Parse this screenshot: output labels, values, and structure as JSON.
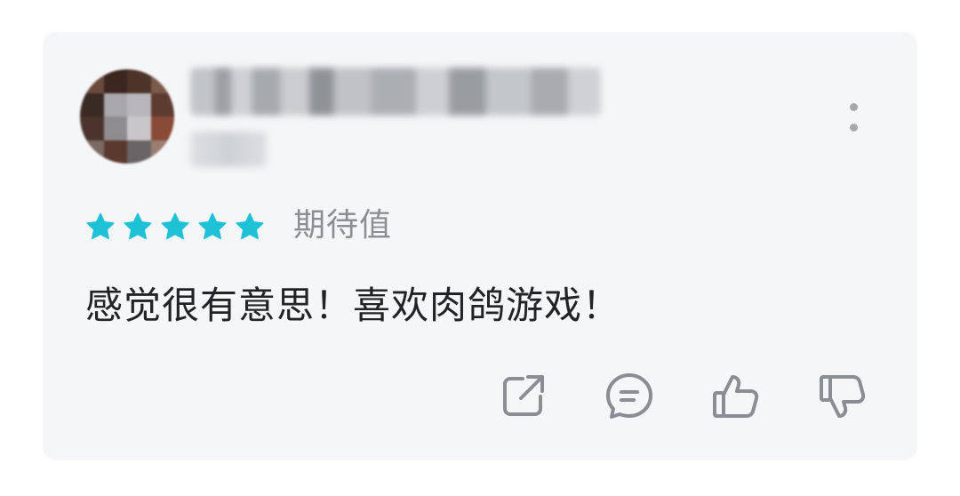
{
  "review": {
    "rating": 5,
    "rating_max": 5,
    "rating_label": "期待值",
    "text": "感觉很有意思！喜欢肉鸽游戏！"
  },
  "colors": {
    "star": "#1fc1d6",
    "icon": "#8a8e94",
    "card_background": "#f5f6f8"
  },
  "icons": {
    "more": "more-vertical-icon",
    "share": "share-icon",
    "comment": "comment-icon",
    "like": "thumbs-up-icon",
    "dislike": "thumbs-down-icon"
  }
}
